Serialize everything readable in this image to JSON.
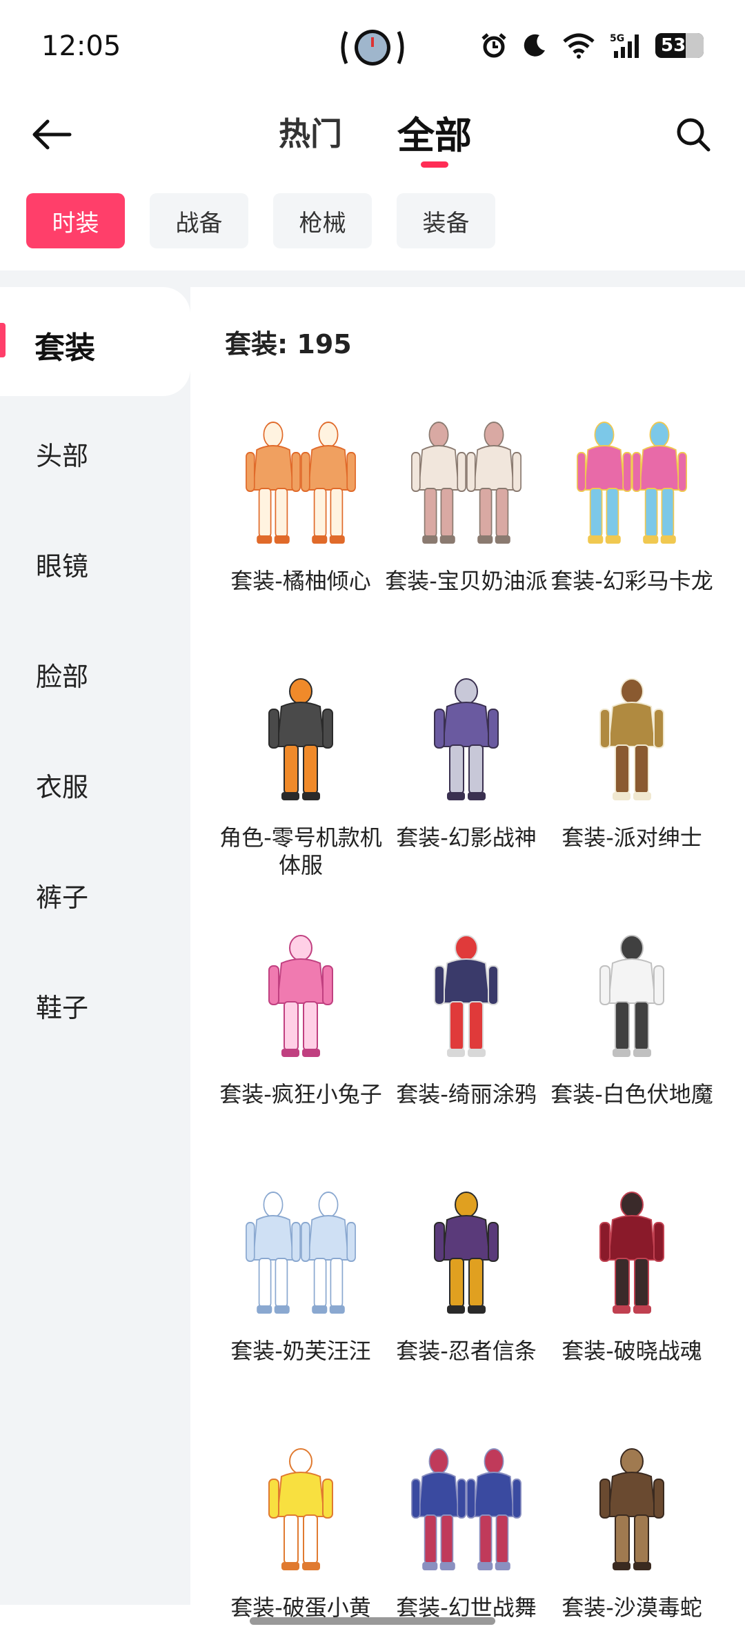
{
  "status_bar": {
    "time": "12:05",
    "battery": "53"
  },
  "header": {
    "tabs": [
      "热门",
      "全部"
    ],
    "active_tab": "全部"
  },
  "chips": [
    {
      "label": "时装",
      "active": true
    },
    {
      "label": "战备",
      "active": false
    },
    {
      "label": "枪械",
      "active": false
    },
    {
      "label": "装备",
      "active": false
    }
  ],
  "sidebar": {
    "active": "套装",
    "items": [
      "头部",
      "眼镜",
      "脸部",
      "衣服",
      "裤子",
      "鞋子"
    ]
  },
  "content": {
    "count_label": "套装: 195",
    "items": [
      {
        "name": "套装-橘柚倾心",
        "icon": "outfit-pair-orange"
      },
      {
        "name": "套装-宝贝奶油派",
        "icon": "outfit-pair-cream"
      },
      {
        "name": "套装-幻彩马卡龙",
        "icon": "outfit-pair-rainbow"
      },
      {
        "name": "角色-零号机款机体服",
        "icon": "outfit-bodysuit-orange"
      },
      {
        "name": "套装-幻影战神",
        "icon": "outfit-armor-purple"
      },
      {
        "name": "套装-派对绅士",
        "icon": "outfit-suit-gold"
      },
      {
        "name": "套装-疯狂小兔子",
        "icon": "outfit-bunny-pink"
      },
      {
        "name": "套装-绮丽涂鸦",
        "icon": "outfit-jacket-graffiti"
      },
      {
        "name": "套装-白色伏地魔",
        "icon": "outfit-hoodie-white"
      },
      {
        "name": "套装-奶芙汪汪",
        "icon": "outfit-pair-puppy"
      },
      {
        "name": "套装-忍者信条",
        "icon": "outfit-ninja-purple"
      },
      {
        "name": "套装-破晓战魂",
        "icon": "outfit-coat-red"
      },
      {
        "name": "套装-破蛋小黄",
        "icon": "outfit-chick-yellow"
      },
      {
        "name": "套装-幻世战舞",
        "icon": "outfit-pair-blue"
      },
      {
        "name": "套装-沙漠毒蛇",
        "icon": "outfit-desert-brown"
      }
    ]
  },
  "colors": {
    "accent": "#ff3f6a",
    "sidebar_bg": "#f2f4f6",
    "chip_bg": "#f3f5f7"
  }
}
